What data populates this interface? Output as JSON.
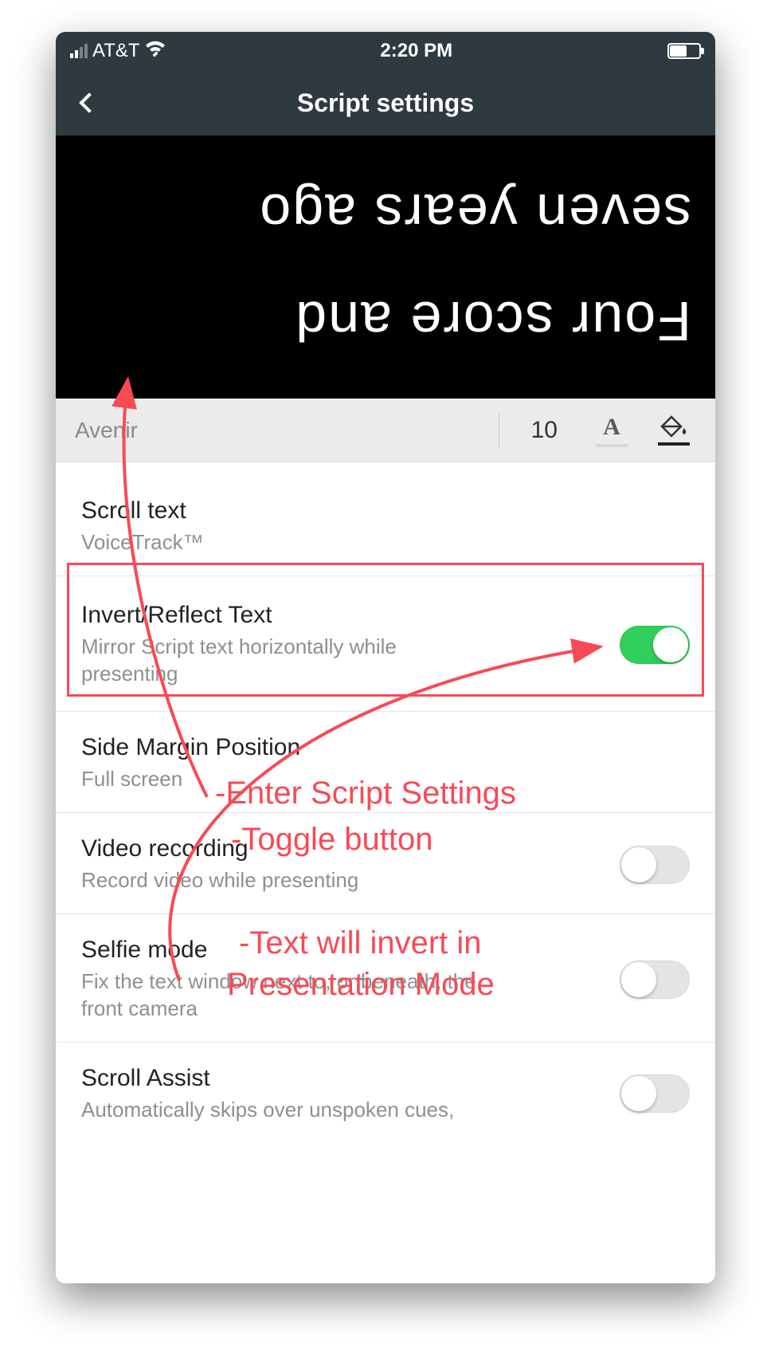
{
  "status": {
    "carrier": "AT&T",
    "time": "2:20 PM"
  },
  "header": {
    "title": "Script settings"
  },
  "preview": {
    "line1": "Four score and",
    "line2": "seven years ago"
  },
  "fontbar": {
    "font_name": "Avenir",
    "font_size": "10"
  },
  "settings": {
    "scroll_text": {
      "title": "Scroll text",
      "sub": "VoiceTrack™"
    },
    "invert": {
      "title": "Invert/Reflect Text",
      "sub": "Mirror Script text horizontally while presenting",
      "on": true
    },
    "margin": {
      "title": "Side Margin Position",
      "sub": "Full screen"
    },
    "video": {
      "title": "Video recording",
      "sub": "Record video while presenting",
      "on": false
    },
    "selfie": {
      "title": "Selfie mode",
      "sub": "Fix the text window next to, or beneath, the front camera",
      "on": false
    },
    "assist": {
      "title": "Scroll Assist",
      "sub": "Automatically skips over unspoken cues,",
      "on": false
    }
  },
  "annotations": {
    "a1": "-Enter Script Settings",
    "a2": "-Toggle button",
    "a3": "-Text will invert in",
    "a4": "Presentation Mode"
  }
}
